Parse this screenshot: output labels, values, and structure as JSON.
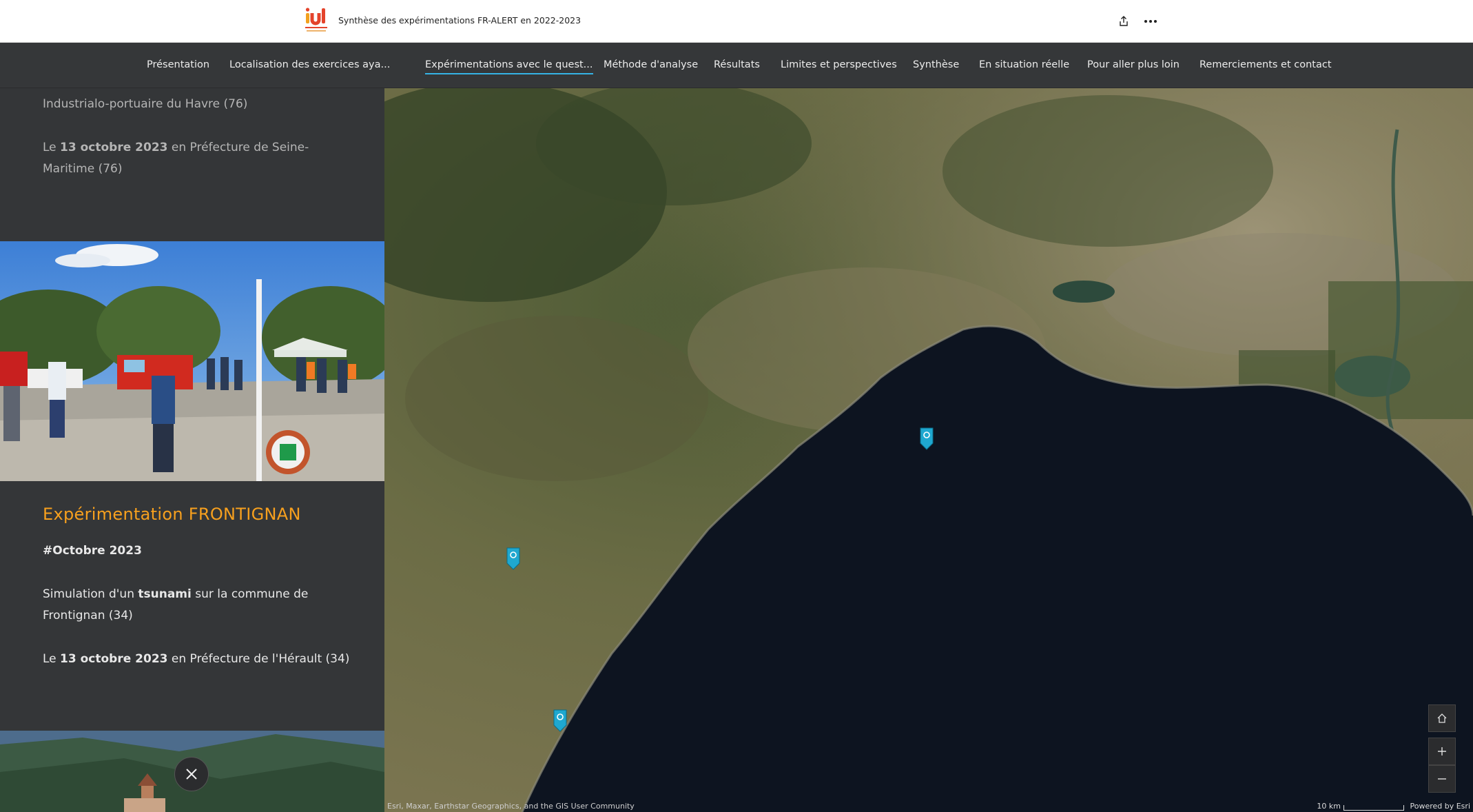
{
  "header": {
    "doc_title": "Synthèse des expérimentations FR-ALERT en 2022-2023",
    "share_icon": "share-icon",
    "more_icon": "more-options-icon"
  },
  "nav": {
    "items": [
      {
        "label": "Présentation"
      },
      {
        "label": "Localisation des exercices aya..."
      },
      {
        "label": "Expérimentations avec le quest...",
        "active": true
      },
      {
        "label": "Méthode d'analyse"
      },
      {
        "label": "Résultats"
      },
      {
        "label": "Limites et perspectives"
      },
      {
        "label": "Synthèse"
      },
      {
        "label": "En situation réelle"
      },
      {
        "label": "Pour aller plus loin"
      },
      {
        "label": "Remerciements et contact"
      }
    ]
  },
  "panel": {
    "prev": {
      "line1": "Industrialo-portuaire du Havre (76)",
      "date_prefix": "Le ",
      "date": "13 octobre 2023",
      "date_suffix": " en Préfecture de Seine-Maritime (76)"
    },
    "frontignan": {
      "title": "Expérimentation FRONTIGNAN",
      "hashtag": "#Octobre 2023",
      "desc_prefix": "Simulation d'un ",
      "desc_bold": "tsunami",
      "desc_suffix": " sur la commune de Frontignan (34)",
      "date_prefix": "Le ",
      "date": "13 octobre 2023",
      "date_suffix": " en Préfecture de l'Hérault (34)"
    }
  },
  "map": {
    "attribution": "Esri, Maxar, Earthstar Geographics, and the GIS User Community",
    "scale_label": "10 km",
    "powered_by": "Powered by Esri",
    "accent_color": "#1fa8d0"
  },
  "colors": {
    "header_bg": "#ffffff",
    "panel_bg": "#343638",
    "title_orange": "#f7a01e",
    "active_underline": "#35b4e6",
    "sea": "#0d1420"
  }
}
